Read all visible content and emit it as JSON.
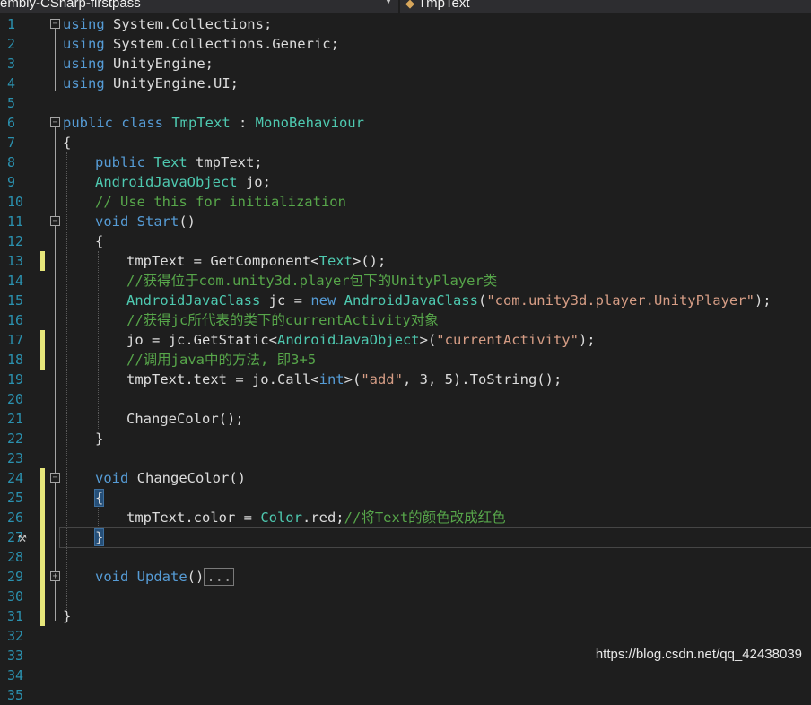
{
  "navbar": {
    "project": "embly-CSharp-firstpass",
    "member": "TmpText"
  },
  "line_numbers": [
    "1",
    "2",
    "3",
    "4",
    "5",
    "6",
    "7",
    "8",
    "9",
    "10",
    "11",
    "12",
    "13",
    "14",
    "15",
    "16",
    "17",
    "18",
    "19",
    "20",
    "21",
    "22",
    "23",
    "24",
    "25",
    "26",
    "27",
    "28",
    "29",
    "30",
    "31",
    "32",
    "33",
    "34",
    "35"
  ],
  "code": {
    "l1": {
      "kw": "using",
      "rest": " System.Collections;"
    },
    "l2": {
      "kw": "using",
      "rest": " System.Collections.Generic;"
    },
    "l3": {
      "kw": "using",
      "rest": " UnityEngine;"
    },
    "l4": {
      "kw": "using",
      "rest": " UnityEngine.UI;"
    },
    "l6": {
      "kw": "public class",
      "cls": "TmpText",
      "sep": " : ",
      "base": "MonoBehaviour"
    },
    "l7": {
      "text": "{"
    },
    "l8": {
      "kw": "public",
      "ty": "Text",
      "rest": " tmpText;"
    },
    "l9": {
      "ty": "AndroidJavaObject",
      "rest": " jo;"
    },
    "l10": {
      "comment": "// Use this for initialization"
    },
    "l11": {
      "kw": "void",
      "name": "Start",
      "rest": "()"
    },
    "l12": {
      "text": "{"
    },
    "l13": {
      "a": "tmpText = GetComponent<",
      "ty": "Text",
      "b": ">();"
    },
    "l14": {
      "comment": "//获得位于com.unity3d.player包下的UnityPlayer类"
    },
    "l15": {
      "ty": "AndroidJavaClass",
      "a": " jc = ",
      "kw": "new",
      "ty2": "AndroidJavaClass",
      "b": "(",
      "str": "\"com.unity3d.player.UnityPlayer\"",
      "c": ");"
    },
    "l16": {
      "comment": "//获得jc所代表的类下的currentActivity对象"
    },
    "l17": {
      "a": "jo = jc.GetStatic<",
      "ty": "AndroidJavaObject",
      "b": ">(",
      "str": "\"currentActivity\"",
      "c": ");"
    },
    "l18": {
      "comment": "//调用java中的方法, 即3+5"
    },
    "l19": {
      "a": "tmpText.text = jo.Call<",
      "kw": "int",
      "b": ">(",
      "str": "\"add\"",
      "c": ", 3, 5).ToString();"
    },
    "l21": {
      "text": "ChangeColor();"
    },
    "l22": {
      "text": "}"
    },
    "l24": {
      "kw": "void",
      "name": "ChangeColor",
      "rest": "()"
    },
    "l25": {
      "text": "{"
    },
    "l26": {
      "a": "tmpText.color = ",
      "ty": "Color",
      "b": ".red;",
      "comment": "//将Text的颜色改成红色"
    },
    "l27": {
      "text": "}"
    },
    "l29": {
      "kw": "void",
      "name": "Update",
      "rest": "()",
      "collapsed": "..."
    },
    "l34": {
      "text": "}"
    }
  },
  "watermark": "https://blog.csdn.net/qq_42438039",
  "colors": {
    "keyword": "#569cd6",
    "type": "#4ec9b0",
    "comment": "#57a64a",
    "string": "#d69d85",
    "background": "#1e1e1e",
    "line_number": "#2b91af",
    "change_marker": "#e6e67a"
  },
  "icons": {
    "fold": "minus-box-icon",
    "expand": "plus-box-icon",
    "quick_action": "screwdriver-icon"
  }
}
